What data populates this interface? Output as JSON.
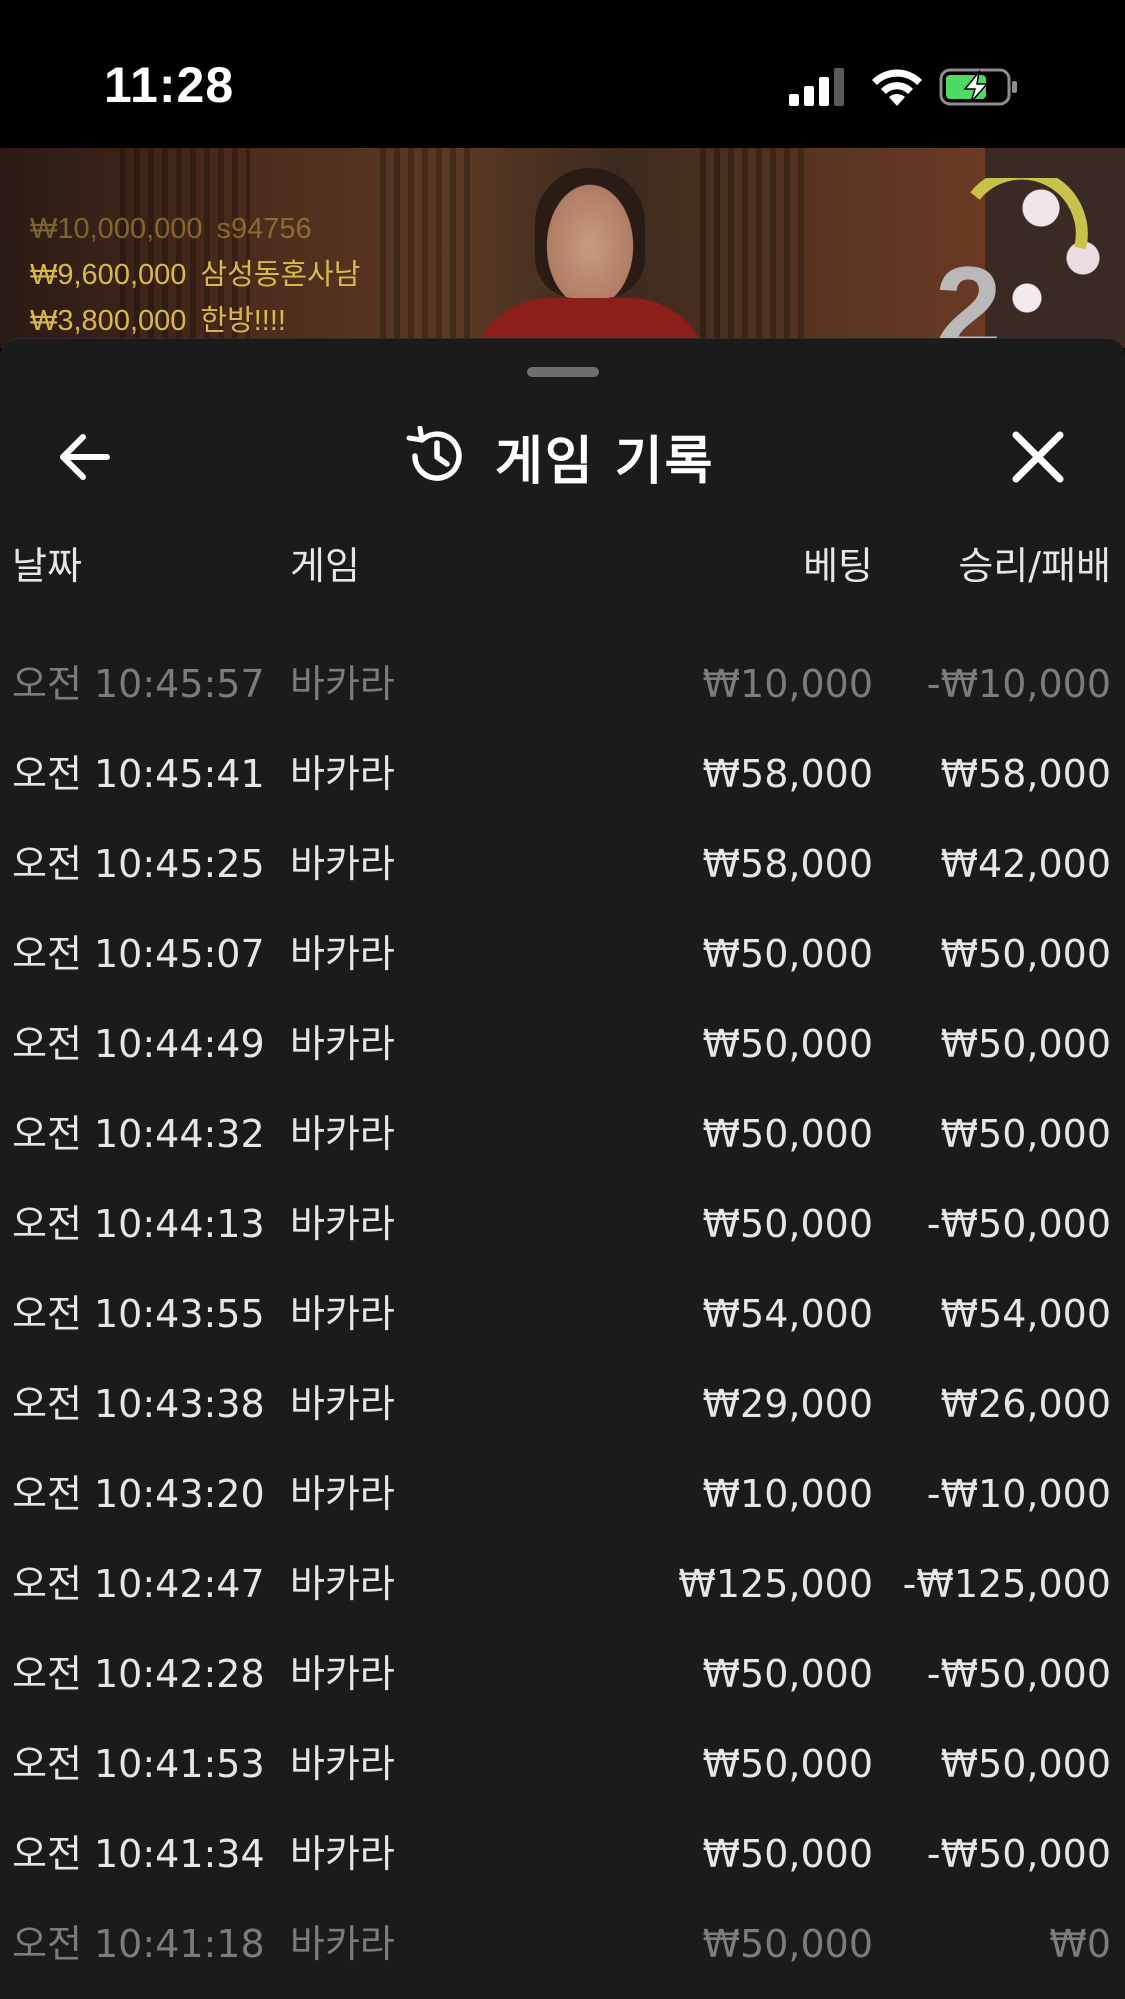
{
  "status_bar": {
    "time": "11:28",
    "icons": [
      "cellular-signal-icon",
      "wifi-icon",
      "battery-charging-icon"
    ],
    "battery_color": "#4cd964"
  },
  "live_video": {
    "winners": [
      {
        "amount": "₩10,000,000",
        "name": "s94756"
      },
      {
        "amount": "₩9,600,000",
        "name": "삼성동혼사남"
      },
      {
        "amount": "₩3,800,000",
        "name": "한방!!!!"
      }
    ],
    "countdown": "2",
    "winner_color": "#d9b84a"
  },
  "sheet": {
    "title": "게임 기록",
    "title_icon": "history-icon",
    "back_icon": "arrow-left-icon",
    "close_icon": "close-icon",
    "columns": {
      "date": "날짜",
      "game": "게임",
      "bet": "베팅",
      "result": "승리/패배"
    },
    "rows": [
      {
        "time": "오전 10:45:57",
        "game": "바카라",
        "bet": "₩10,000",
        "result": "-₩10,000"
      },
      {
        "time": "오전 10:45:41",
        "game": "바카라",
        "bet": "₩58,000",
        "result": "₩58,000"
      },
      {
        "time": "오전 10:45:25",
        "game": "바카라",
        "bet": "₩58,000",
        "result": "₩42,000"
      },
      {
        "time": "오전 10:45:07",
        "game": "바카라",
        "bet": "₩50,000",
        "result": "₩50,000"
      },
      {
        "time": "오전 10:44:49",
        "game": "바카라",
        "bet": "₩50,000",
        "result": "₩50,000"
      },
      {
        "time": "오전 10:44:32",
        "game": "바카라",
        "bet": "₩50,000",
        "result": "₩50,000"
      },
      {
        "time": "오전 10:44:13",
        "game": "바카라",
        "bet": "₩50,000",
        "result": "-₩50,000"
      },
      {
        "time": "오전 10:43:55",
        "game": "바카라",
        "bet": "₩54,000",
        "result": "₩54,000"
      },
      {
        "time": "오전 10:43:38",
        "game": "바카라",
        "bet": "₩29,000",
        "result": "₩26,000"
      },
      {
        "time": "오전 10:43:20",
        "game": "바카라",
        "bet": "₩10,000",
        "result": "-₩10,000"
      },
      {
        "time": "오전 10:42:47",
        "game": "바카라",
        "bet": "₩125,000",
        "result": "-₩125,000"
      },
      {
        "time": "오전 10:42:28",
        "game": "바카라",
        "bet": "₩50,000",
        "result": "-₩50,000"
      },
      {
        "time": "오전 10:41:53",
        "game": "바카라",
        "bet": "₩50,000",
        "result": "₩50,000"
      },
      {
        "time": "오전 10:41:34",
        "game": "바카라",
        "bet": "₩50,000",
        "result": "-₩50,000"
      },
      {
        "time": "오전 10:41:18",
        "game": "바카라",
        "bet": "₩50,000",
        "result": "₩0"
      }
    ]
  }
}
